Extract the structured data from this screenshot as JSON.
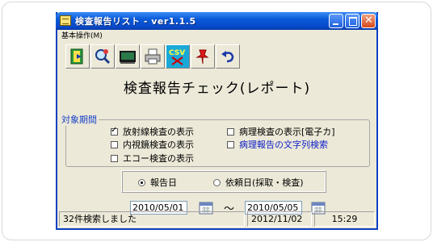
{
  "window": {
    "title": "検査報告リスト - ver1.1.5"
  },
  "menu": {
    "items": [
      {
        "label": "基本操作(M)"
      }
    ]
  },
  "toolbar": {
    "buttons": [
      {
        "icon": "exit-door-icon"
      },
      {
        "icon": "search-magnifier-icon"
      },
      {
        "icon": "monitor-display-icon"
      },
      {
        "icon": "printer-icon"
      },
      {
        "icon": "csv-export-icon",
        "label": "CSV"
      },
      {
        "icon": "pin-icon"
      },
      {
        "icon": "undo-arrow-icon"
      }
    ]
  },
  "main": {
    "heading": "検査報告チェック(レポート)",
    "period_group_label": "対象期間",
    "checkboxes": [
      {
        "label": "放射線検査の表示",
        "checked": true
      },
      {
        "label": "病理検査の表示[電子カ]",
        "checked": false
      },
      {
        "label": "内視鏡検査の表示",
        "checked": false
      },
      {
        "label": "病理報告の文字列検索",
        "checked": false
      },
      {
        "label": "エコー検査の表示",
        "checked": false
      }
    ],
    "radios": [
      {
        "label": "報告日",
        "selected": true
      },
      {
        "label": "依頼日(採取・検査)",
        "selected": false
      }
    ],
    "date_from": "2010/05/01",
    "date_separator": "〜",
    "date_to": "2010/05/05"
  },
  "status": {
    "message": "32件検索しました",
    "date": "2012/11/02",
    "time": "15:29"
  },
  "colors": {
    "titlebar": "#0a5ad8",
    "window_bg": "#ece9d8",
    "group_label": "#1842c8",
    "link_checkbox": "#1020c8"
  }
}
